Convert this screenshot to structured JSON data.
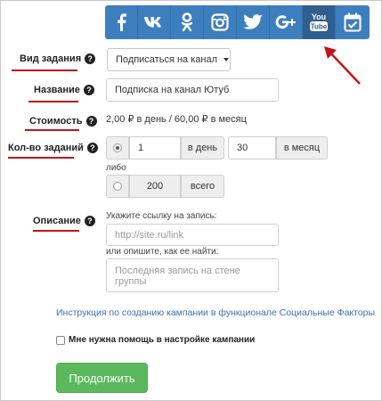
{
  "social": [
    {
      "name": "facebook-icon",
      "glyph": "f"
    },
    {
      "name": "vk-icon",
      "glyph": "vk"
    },
    {
      "name": "odnoklassniki-icon",
      "glyph": "ok"
    },
    {
      "name": "instagram-icon",
      "glyph": "ig"
    },
    {
      "name": "twitter-icon",
      "glyph": "tw"
    },
    {
      "name": "google-plus-icon",
      "glyph": "g+"
    },
    {
      "name": "youtube-icon",
      "glyph": "You Tube",
      "active": true
    },
    {
      "name": "calendar-check-icon",
      "glyph": "cal"
    }
  ],
  "colors": {
    "social_bar": "#3d7ebf",
    "social_active": "#2f5f8f",
    "accent_underline": "#c0161b",
    "link": "#3b73b0",
    "button": "#5cb85c"
  },
  "fields": {
    "task_type": {
      "label": "Вид задания",
      "value": "Подписаться на канал"
    },
    "title": {
      "label": "Название",
      "value": "Подписка на канал Ютуб"
    },
    "cost": {
      "label": "Стоимость",
      "value": "2,00 ₽ в день / 60,00 ₽ в месяц"
    },
    "task_count": {
      "label": "Кол-во заданий",
      "per_day_value": "1",
      "per_day_unit": "в день",
      "per_month_value": "30",
      "per_month_unit": "в месяц",
      "or_text": "либо",
      "total_value": "200",
      "total_unit": "всего"
    },
    "description": {
      "label": "Описание",
      "link_prompt": "Укажите ссылку на запись:",
      "link_placeholder": "http://site.ru/link",
      "how_prompt": "или опишите, как ее найти:",
      "how_placeholder": "Последняя запись на стене группы"
    }
  },
  "help_glyph": "?",
  "instruction_link": "Инструкция по созданию кампании в функционале Социальные Факторы",
  "help_checkbox_label": "Мне нужна помощь в настройке кампании",
  "continue_button": "Продолжить"
}
